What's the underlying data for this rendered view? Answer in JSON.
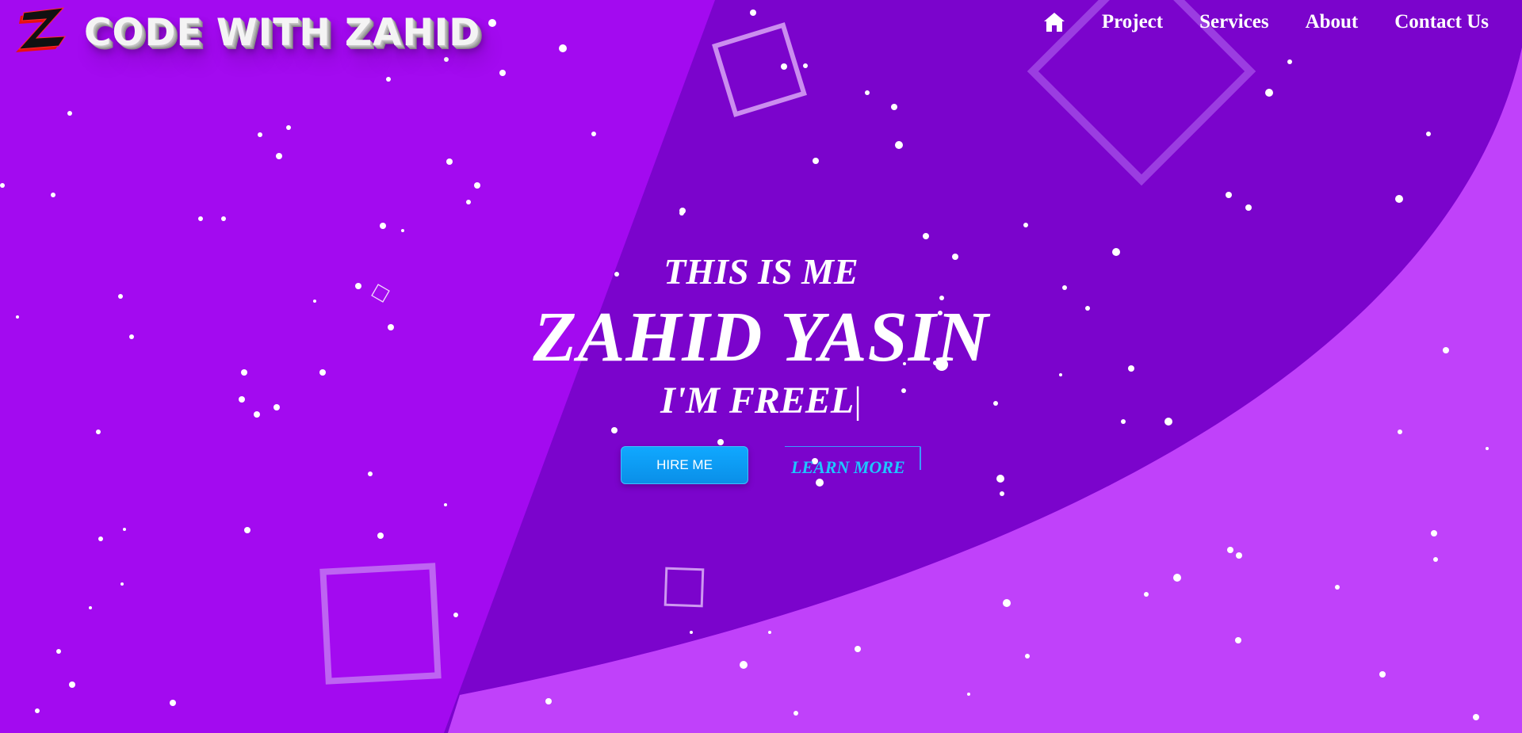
{
  "header": {
    "logo_text": "CODE WITH ZAHID",
    "nav": {
      "home_icon": "home-icon",
      "items": [
        "Project",
        "Services",
        "About",
        "Contact Us"
      ]
    }
  },
  "hero": {
    "intro": "THIS IS ME",
    "name": "ZAHID YASIN",
    "typed_text": "I'M FREEL",
    "caret": "|",
    "hire_button": "HIRE ME",
    "learn_button": "LEARN MORE"
  },
  "colors": {
    "background": "#a30af0",
    "dark_wedge": "#7b04cc",
    "light_corner": "#c041fa",
    "hire_button": "#0a9bf5",
    "learn_text": "#1ec6ff",
    "logo_red": "#e81010"
  }
}
